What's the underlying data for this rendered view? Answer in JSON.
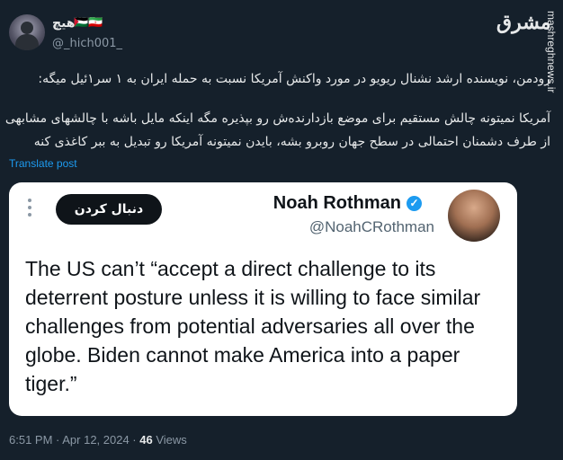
{
  "author": {
    "display_name": "هیچ",
    "handle": "@_hich001_"
  },
  "brand": {
    "logo_text": "مشرق",
    "side_text": "mashreghnews.ir"
  },
  "tweet": {
    "lines": [
      "رودمن، نویسنده ارشد نشنال ریویو در مورد واکنش آمریکا نسبت به حمله ایران به ۱ سر۱ئیل میگه:",
      "آمریکا نمیتونه چالش مستقیم برای موضع بازدارنده‌ش رو بپذیره مگه اینکه مایل باشه با چالشهای مشابهی",
      "از طرف دشمنان احتمالی در سطح جهان روبرو بشه، بایدن نمیتونه آمریکا رو تبدیل به ببر کاغذی کنه"
    ],
    "translate_label": "Translate post"
  },
  "card": {
    "name": "Noah Rothman",
    "handle": "@NoahCRothman",
    "follow_label": "دنبال کردن",
    "quote": "The US can’t “accept a direct challenge to its deterrent posture unless it is willing to face similar challenges from potential adversaries all over the globe. Biden cannot make America into a paper tiger.”"
  },
  "meta": {
    "time": "6:51 PM · Apr 12, 2024 ·",
    "views_count": "46",
    "views_label": "Views"
  },
  "colors": {
    "background": "#15202b",
    "link": "#1d9bf0",
    "verified": "#1d9bf0"
  }
}
